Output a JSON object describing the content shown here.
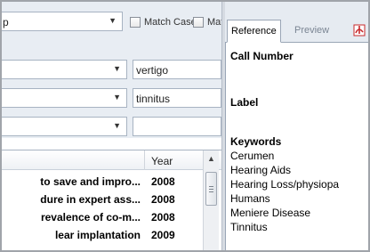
{
  "search": {
    "row1": {
      "combo_value": "p",
      "match_case_label": "Match Case",
      "match_words_label": "Mat"
    },
    "row2": {
      "field_value": "",
      "text_value": "vertigo"
    },
    "row3": {
      "field_value": "",
      "text_value": "tinnitus"
    },
    "row4": {
      "field_value": "",
      "text_value": ""
    }
  },
  "table": {
    "year_header": "Year",
    "rows": [
      {
        "title": "to save and impro...",
        "year": "2008"
      },
      {
        "title": "dure in expert ass...",
        "year": "2008"
      },
      {
        "title": "revalence of co-m...",
        "year": "2008"
      },
      {
        "title": "lear implantation",
        "year": "2009"
      }
    ]
  },
  "reference": {
    "tabs": {
      "reference": "Reference",
      "preview": "Preview"
    },
    "pdf_icon": "pdf-icon",
    "headings": {
      "call_number": "Call Number",
      "label": "Label",
      "keywords": "Keywords"
    },
    "keywords": [
      "Cerumen",
      "Hearing Aids",
      "Hearing Loss/physiopa",
      "Humans",
      "Meniere Disease",
      "Tinnitus"
    ]
  },
  "colors": {
    "panel_bg": "#e8edf3",
    "border": "#a7b3c2",
    "pdf_red": "#c8282a"
  }
}
